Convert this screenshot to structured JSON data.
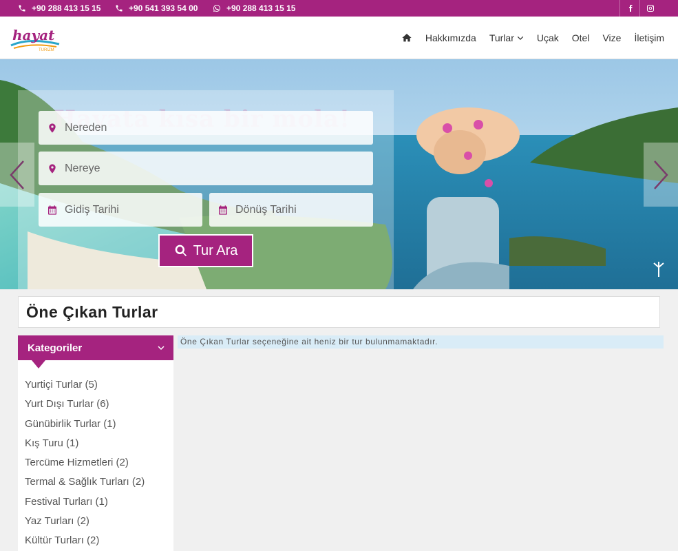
{
  "topbar": {
    "phone1": "+90 288 413 15 15",
    "phone2": "+90 541 393 54 00",
    "whatsapp": "+90 288 413 15 15",
    "icons": [
      "phone-icon",
      "phone-icon",
      "whatsapp-icon",
      "facebook-icon",
      "instagram-icon"
    ]
  },
  "header": {
    "logo_text": "hayat",
    "logo_subtext": "TURIZM",
    "nav": {
      "home_icon": "home-icon",
      "about": "Hakkımızda",
      "tours": "Turlar",
      "flight": "Uçak",
      "hotel": "Otel",
      "visa": "Vize",
      "contact": "İletişim"
    }
  },
  "hero": {
    "title": "Hayata kısa bir mola!",
    "from_placeholder": "Nereden",
    "to_placeholder": "Nereye",
    "depart_placeholder": "Gidiş Tarihi",
    "return_placeholder": "Dönüş Tarihi",
    "search_label": "Tur Ara"
  },
  "section": {
    "title": "Öne Çıkan Turlar"
  },
  "sidebar": {
    "title": "Kategoriler",
    "categories": [
      "Yurtiçi Turlar (5)",
      "Yurt Dışı Turlar (6)",
      "Günübirlik Turlar (1)",
      "Kış Turu (1)",
      "Tercüme Hizmetleri (2)",
      "Termal & Sağlık Turları (2)",
      "Festival Turları (1)",
      "Yaz Turları (2)",
      "Kültür Turları (2)"
    ]
  },
  "notice": "Öne Çıkan Turlar seçeneğine ait heniz bir tur bulunmamaktadır.",
  "colors": {
    "brand": "#a5237f",
    "notice_bg": "#d9ecf7"
  }
}
